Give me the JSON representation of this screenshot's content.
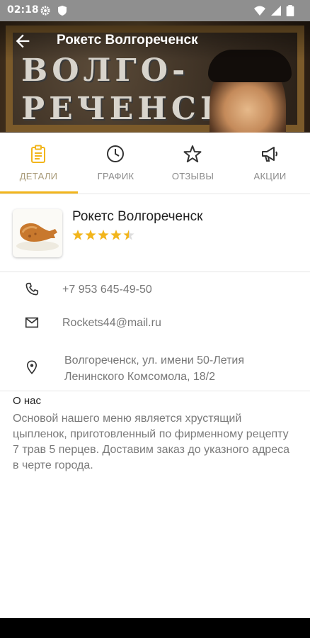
{
  "status": {
    "time": "02:18"
  },
  "header": {
    "title": "Рокетс Волгореченск",
    "banner_line1": "ВОЛГО-",
    "banner_line2": "РЕЧЕНСК"
  },
  "tabs": [
    {
      "label": "ДЕТАЛИ",
      "icon": "clipboard-icon",
      "active": true
    },
    {
      "label": "ГРАФИК",
      "icon": "clock-icon",
      "active": false
    },
    {
      "label": "ОТЗЫВЫ",
      "icon": "star-outline-icon",
      "active": false
    },
    {
      "label": "АКЦИИ",
      "icon": "megaphone-icon",
      "active": false
    }
  ],
  "place": {
    "name": "Рокетс Волгореченск",
    "rating": 4.5,
    "rating_max": 5
  },
  "contacts": {
    "phone": "+7 953 645-49-50",
    "email": "Rockets44@mail.ru",
    "address_line1": "Волгореченск, ул. имени 50-Летия",
    "address_line2": "Ленинского Комсомола, 18/2"
  },
  "about": {
    "heading": "О нас",
    "text": "Основой нашего меню является хрустящий цыпленок, приготовленный по фирменному рецепту 7 трав 5 перцев. Доставим заказ до указного адреса в черте города."
  },
  "colors": {
    "accent": "#f2b51b",
    "statusbar": "#8f8f8f"
  }
}
